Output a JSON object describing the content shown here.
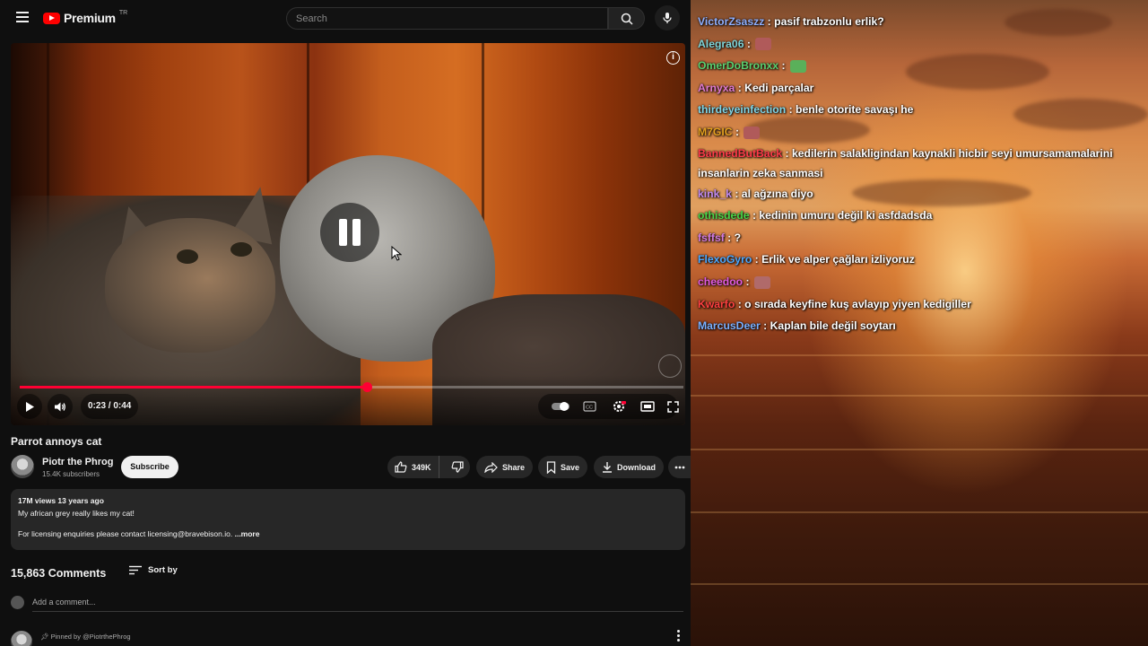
{
  "youtube": {
    "logo_text": "Premium",
    "logo_sup": "TR",
    "search_placeholder": "Search",
    "video": {
      "time": "0:23 / 0:44",
      "progress": 0.523,
      "is_playing": false
    },
    "title": "Parrot annoys cat",
    "channel": {
      "name": "Piotr the Phrog",
      "subscribers": "15.4K subscribers",
      "subscribe_label": "Subscribe"
    },
    "actions": {
      "likes": "349K",
      "share": "Share",
      "save": "Save",
      "download": "Download"
    },
    "description": {
      "meta": "17M views  13 years ago",
      "line1": "My african grey really likes my cat!",
      "line2": "For licensing enquiries please contact licensing@bravebison.io.",
      "more": "...more"
    },
    "comments": {
      "count": "15,863 Comments",
      "sort_by": "Sort by",
      "add_placeholder": "Add a comment...",
      "pinned_by": "Pinned by @PiotrthePhrog"
    }
  },
  "chat": {
    "messages": [
      {
        "user": "VictorZsaszz",
        "color": "#8fb0ff",
        "text": "pasif trabzonlu erlik?",
        "emote": false
      },
      {
        "user": "Alegra06",
        "color": "#7fd4d8",
        "text": "",
        "emote": true
      },
      {
        "user": "OmerDoBronxx",
        "color": "#5ad070",
        "text": "",
        "emote": true
      },
      {
        "user": "Arnyxa",
        "color": "#e07ad0",
        "text": "Kedi parçalar",
        "emote": false
      },
      {
        "user": "thirdeyeinfection",
        "color": "#7fd6e8",
        "text": "benle otorite savaşı he",
        "emote": false
      },
      {
        "user": "M7GIC",
        "color": "#e4a020",
        "text": "",
        "emote": true
      },
      {
        "user": "BannedButBack",
        "color": "#ff3a4a",
        "text": "kedilerin salakligindan kaynakli hicbir seyi umursamamalarini insanlarin zeka sanmasi",
        "emote": false
      },
      {
        "user": "kink_k",
        "color": "#c28cf0",
        "text": "al ağzına diyo",
        "emote": false
      },
      {
        "user": "othisdede",
        "color": "#48d448",
        "text": "kedinin umuru değil ki asfdadsda",
        "emote": false
      },
      {
        "user": "fsffsf",
        "color": "#d27ae0",
        "text": "?",
        "emote": false
      },
      {
        "user": "FlexoGyro",
        "color": "#4aa8ff",
        "text": "Erlik ve alper çağları izliyoruz",
        "emote": false
      },
      {
        "user": "cheedoo",
        "color": "#e05ae0",
        "text": "",
        "emote": true
      },
      {
        "user": "Kwarfo",
        "color": "#ff4040",
        "text": "o sırada keyfine kuş avlayıp yiyen kedigiller",
        "emote": false
      },
      {
        "user": "MarcusDeer",
        "color": "#7ab0ff",
        "text": "Kaplan bile değil soytarı",
        "emote": false
      }
    ]
  },
  "colors": {
    "accent_red": "#ff0033",
    "background": "#0f0f0f",
    "surface": "#272727"
  }
}
